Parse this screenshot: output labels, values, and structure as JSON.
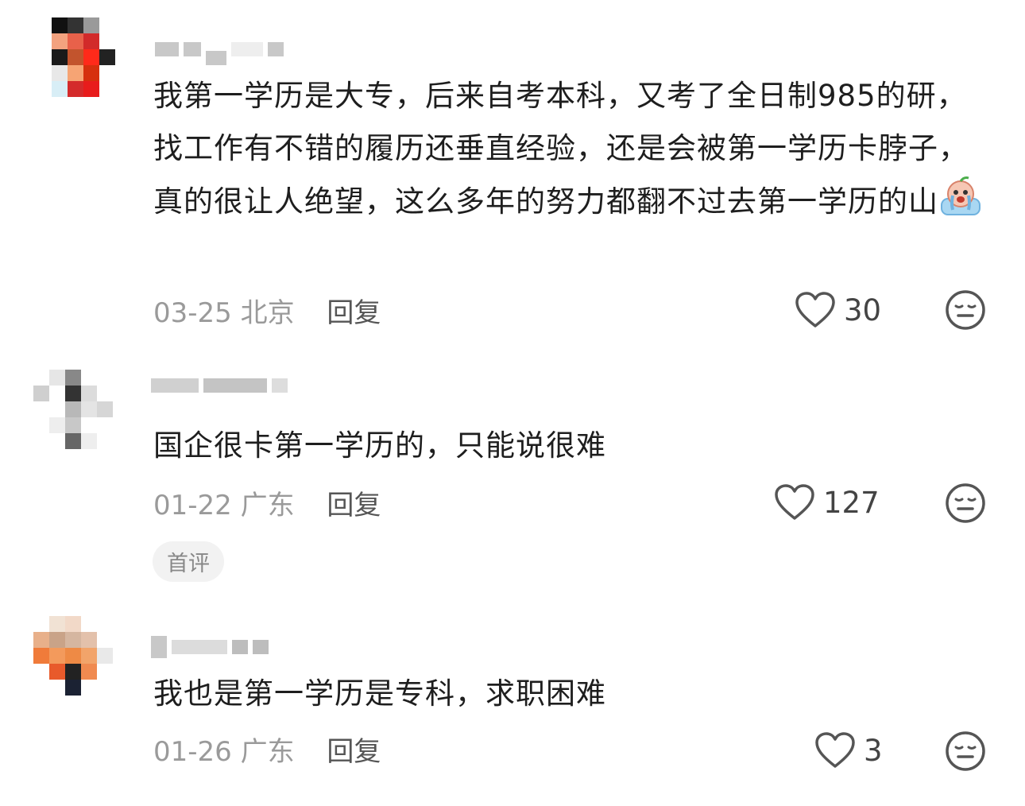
{
  "comments": [
    {
      "text": "我第一学历是大专，后来自考本科，又考了全日制985的研，找工作有不错的履历还垂直经验，还是会被第一学历卡脖子，真的很让人绝望，这么多年的努力都翻不过去第一学历的山",
      "emoji": "crying-face-emoji",
      "date": "03-25",
      "location": "北京",
      "reply_label": "回复",
      "likes": "30"
    },
    {
      "text": "国企很卡第一学历的，只能说很难",
      "date": "01-22",
      "location": "广东",
      "reply_label": "回复",
      "likes": "127",
      "badge": "首评"
    },
    {
      "text": "我也是第一学历是专科，求职困难",
      "date": "01-26",
      "location": "广东",
      "reply_label": "回复",
      "likes": "3"
    }
  ],
  "icons": {
    "like": "heart-outline-icon",
    "reaction": "neutral-face-icon"
  },
  "colors": {
    "text": "#1e1e1e",
    "meta": "#9a9a9a",
    "reply": "#555555"
  }
}
